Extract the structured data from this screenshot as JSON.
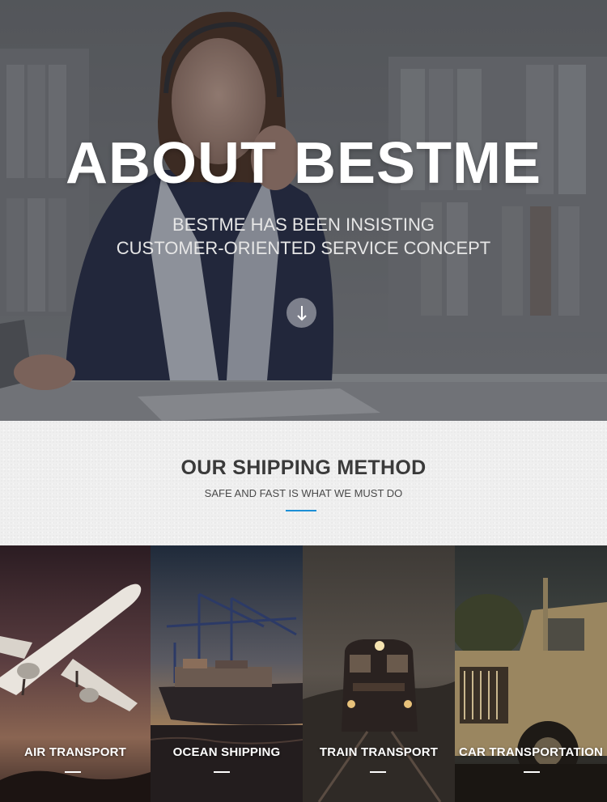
{
  "hero": {
    "title": "ABOUT BESTME",
    "subtitle_line1": "BESTME HAS BEEN INSISTING",
    "subtitle_line2": "CUSTOMER-ORIENTED SERVICE CONCEPT",
    "scroll_icon": "arrow-down-icon"
  },
  "shipping": {
    "title": "OUR SHIPPING METHOD",
    "subtitle": "SAFE AND FAST IS WHAT WE MUST DO",
    "accent_color": "#1d8fd6"
  },
  "methods": [
    {
      "label": "AIR TRANSPORT",
      "icon": "airplane"
    },
    {
      "label": "OCEAN SHIPPING",
      "icon": "cargo-ship"
    },
    {
      "label": "TRAIN TRANSPORT",
      "icon": "train"
    },
    {
      "label": "CAR TRANSPORTATION",
      "icon": "truck"
    }
  ]
}
